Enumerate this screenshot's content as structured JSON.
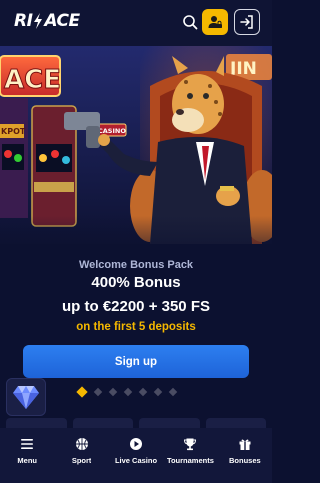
{
  "header": {
    "logo_text_left": "RI",
    "logo_text_right": "ACE",
    "icons": [
      "search-icon",
      "account-icon",
      "login-icon"
    ],
    "colors": {
      "accent": "#f5b800",
      "background": "#0f1434"
    }
  },
  "hero": {
    "sign_left": "ACE",
    "sign_right": "JIN",
    "slot_label": "KPOT",
    "cash_label": "CASINO"
  },
  "promo": {
    "subtitle": "Welcome Bonus Pack",
    "line1": "400% Bonus",
    "line2": "up to €2200 + 350 FS",
    "line3": "on the first 5 deposits",
    "signup_label": "Sign up",
    "carousel_total": 7,
    "carousel_active": 1
  },
  "floating": {
    "icon": "diamond-icon"
  },
  "nav": {
    "items": [
      {
        "label": "Menu",
        "icon": "menu-icon"
      },
      {
        "label": "Sport",
        "icon": "basketball-icon"
      },
      {
        "label": "Live Casino",
        "icon": "play-icon"
      },
      {
        "label": "Tournaments",
        "icon": "trophy-icon"
      },
      {
        "label": "Bonuses",
        "icon": "gift-icon"
      }
    ]
  }
}
